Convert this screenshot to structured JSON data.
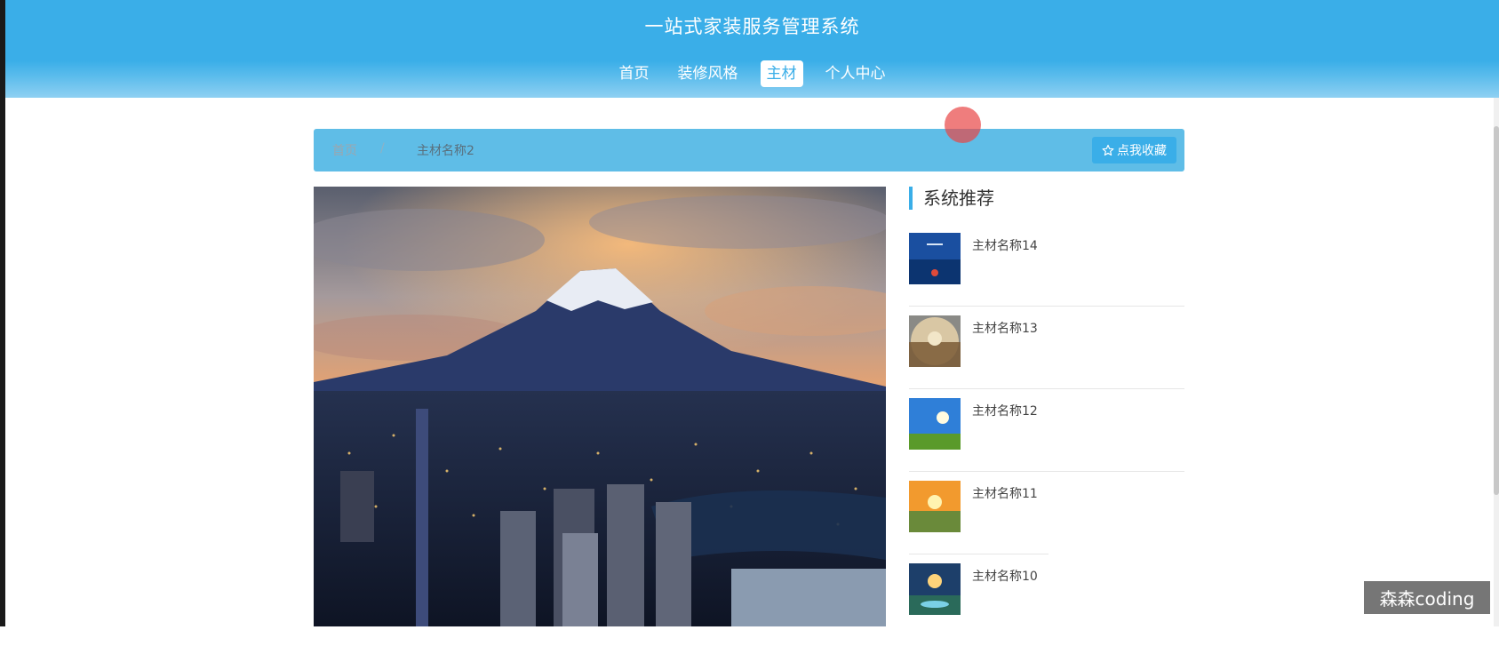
{
  "header": {
    "title": "一站式家装服务管理系统",
    "nav": [
      {
        "label": "首页",
        "active": false
      },
      {
        "label": "装修风格",
        "active": false
      },
      {
        "label": "主材",
        "active": true
      },
      {
        "label": "个人中心",
        "active": false
      }
    ]
  },
  "breadcrumb": {
    "home": "首页",
    "separator": "/",
    "current": "主材名称2"
  },
  "collect_button": {
    "icon": "star-outline-icon",
    "label": "点我收藏"
  },
  "sidebar": {
    "heading": "系统推荐",
    "items": [
      {
        "label": "主材名称14"
      },
      {
        "label": "主材名称13"
      },
      {
        "label": "主材名称12"
      },
      {
        "label": "主材名称11"
      },
      {
        "label": "主材名称10"
      }
    ]
  },
  "watermark": "森森coding",
  "colors": {
    "accent": "#3aaee8",
    "breadcrumb_bg": "#5fbde7"
  }
}
